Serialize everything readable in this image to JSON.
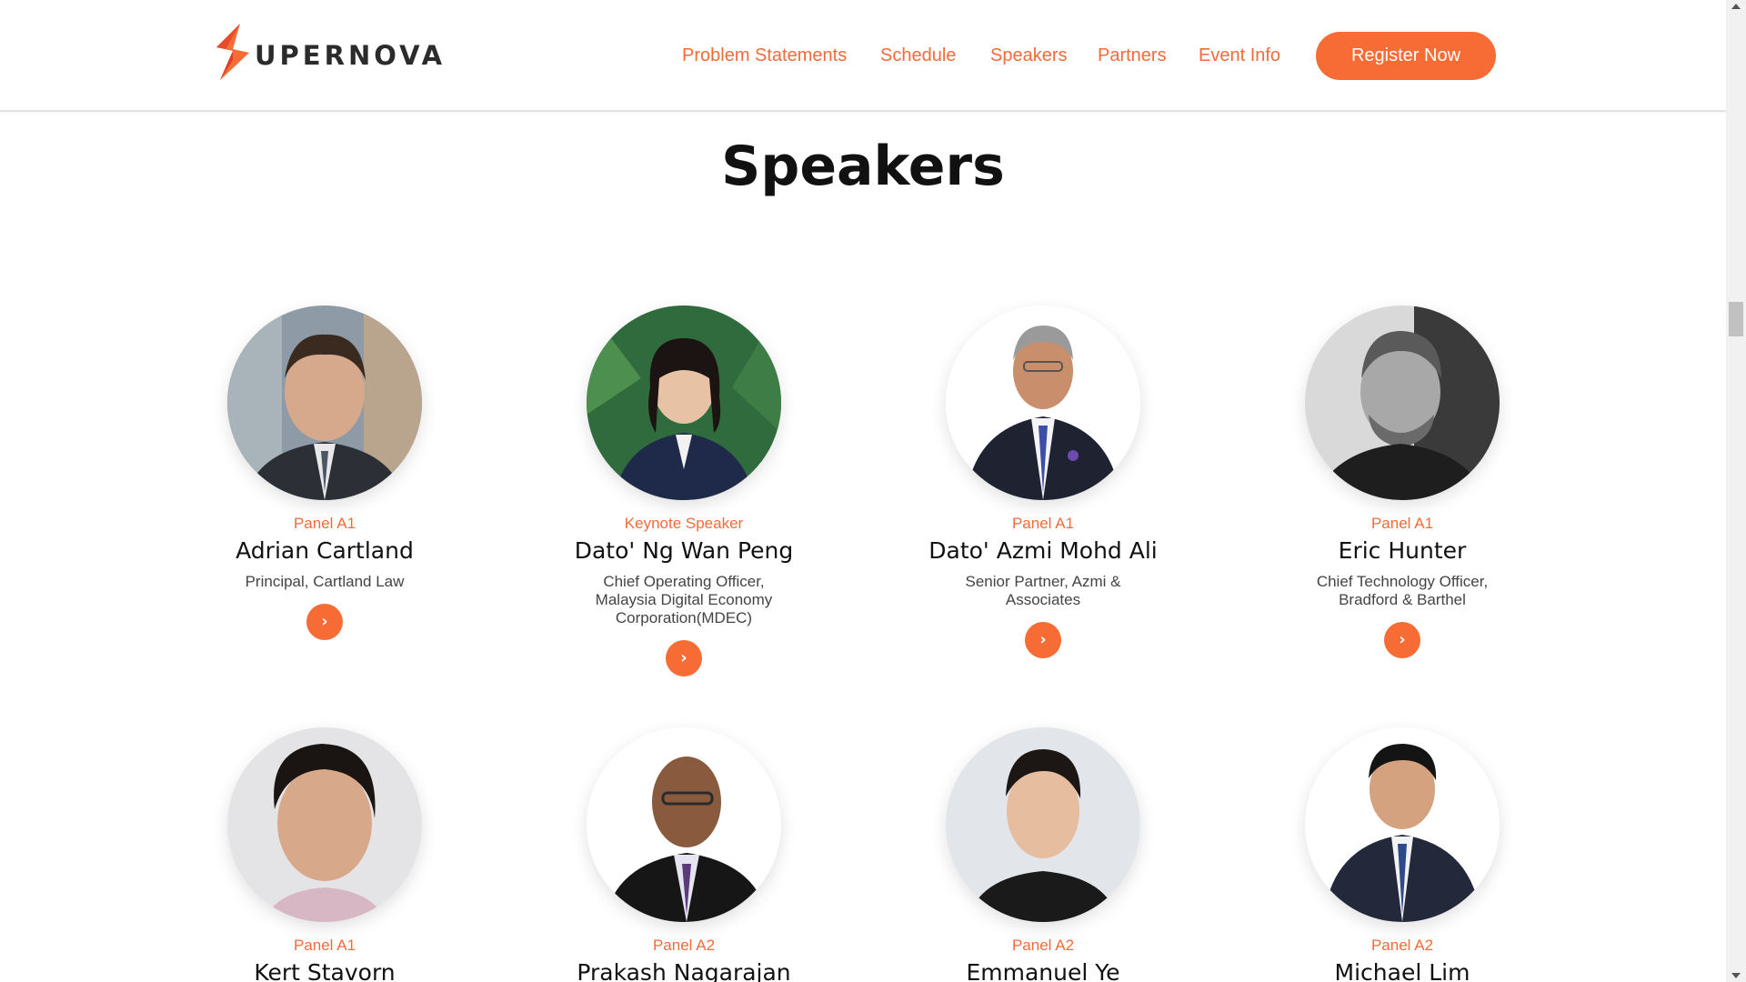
{
  "brand": {
    "logo_text": "UPERNOVA",
    "accent_color": "#f76b35",
    "text_accent": "#f26b3a"
  },
  "nav": {
    "items": [
      "Problem Statements",
      "Schedule",
      "Speakers",
      "Partners",
      "Event Info"
    ],
    "register_label": "Register Now"
  },
  "section": {
    "title": "Speakers"
  },
  "speakers": [
    {
      "role": "Panel A1",
      "name": "Adrian Cartland",
      "title": "Principal, Cartland Law"
    },
    {
      "role": "Keynote Speaker",
      "name": "Dato' Ng Wan Peng",
      "title": "Chief Operating Officer, Malaysia Digital Economy Corporation(MDEC)"
    },
    {
      "role": "Panel A1",
      "name": "Dato' Azmi Mohd Ali",
      "title": "Senior Partner, Azmi & Associates"
    },
    {
      "role": "Panel A1",
      "name": "Eric Hunter",
      "title": "Chief Technology Officer, Bradford & Barthel"
    },
    {
      "role": "Panel A1",
      "name": "Kert Stavorn",
      "title": ""
    },
    {
      "role": "Panel A2",
      "name": "Prakash Nagarajan",
      "title": ""
    },
    {
      "role": "Panel A2",
      "name": "Emmanuel Ye",
      "title": ""
    },
    {
      "role": "Panel A2",
      "name": "Michael Lim",
      "title": ""
    }
  ],
  "icons": {
    "card_button": "chevron-right-icon",
    "logo": "supernova-s-logo-icon"
  }
}
